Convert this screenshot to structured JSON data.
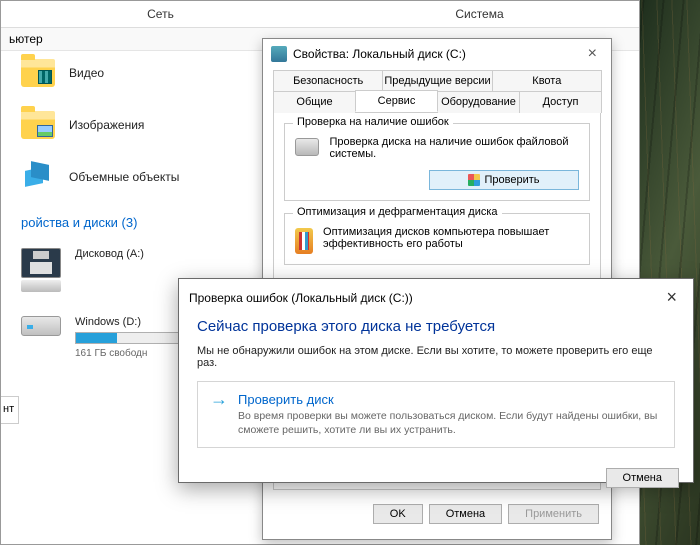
{
  "explorer": {
    "toolbar": {
      "net": "Сеть",
      "sys": "Система"
    },
    "breadcrumb": "ьютер",
    "folders": [
      {
        "label": "Видео",
        "kind": "video"
      },
      {
        "label": "Изображения",
        "kind": "images"
      },
      {
        "label": "Объемные объекты",
        "kind": "3d"
      }
    ],
    "drives_header": "ройства и диски (3)",
    "drives": [
      {
        "label": "Дисковод (A:)",
        "kind": "floppy"
      },
      {
        "label": "Windows (D:)",
        "kind": "hdd",
        "fill_pct": 35,
        "sub": "161 ГБ свободн"
      }
    ],
    "bottom_stub": "нт"
  },
  "props": {
    "title": "Свойства: Локальный диск (C:)",
    "tabs_row1": [
      "Безопасность",
      "Предыдущие версии",
      "Квота"
    ],
    "tabs_row2": [
      "Общие",
      "Сервис",
      "Оборудование",
      "Доступ"
    ],
    "active_tab": "Сервис",
    "group1": {
      "title": "Проверка на наличие ошибок",
      "text": "Проверка диска на наличие ошибок файловой системы.",
      "button": "Проверить"
    },
    "group2": {
      "title": "Оптимизация и дефрагментация диска",
      "text": "Оптимизация дисков компьютера повышает эффективность его работы"
    },
    "buttons": {
      "ok": "OK",
      "cancel": "Отмена",
      "apply": "Применить"
    }
  },
  "check": {
    "title": "Проверка ошибок (Локальный диск (C:))",
    "heading": "Сейчас проверка этого диска не требуется",
    "message": "Мы не обнаружили ошибок на этом диске. Если вы хотите, то можете проверить его еще раз.",
    "action_main": "Проверить диск",
    "action_sub": "Во время проверки вы можете пользоваться диском. Если будут найдены ошибки, вы сможете решить, хотите ли вы их устранить.",
    "cancel": "Отмена"
  }
}
